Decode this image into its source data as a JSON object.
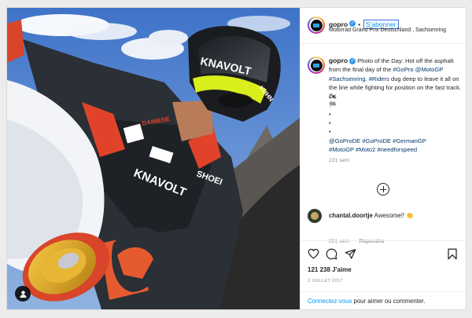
{
  "post": {
    "username": "gopro",
    "follow_label": "S'abonner",
    "location": "Motorrad Grand Prix Deutschland , Sachsenring",
    "photo_alt": "GoPro selfie of a MotoGP rider leaning on a motorcycle"
  },
  "caption": {
    "username": "gopro",
    "text_intro": "Photo of the Day: Hot off the asphalt from the final day of the ",
    "tag_gopro": "#GoPro",
    "tag_motogp": "@MotoGP",
    "tag_sachsenring": "#Sachsenring",
    "tag_riders": "#Riders",
    "text_middle": " dug deep to leave it all on the line while fighting for position on the fast track. ",
    "dots": "•",
    "tags_line1": "@GoProDE #GoProDE #GermanGP",
    "tags_line2": "#MotoGP #Moto2 #needforspeed",
    "time": "221 sem"
  },
  "comment": {
    "username": "chantal.doortje",
    "text": "Awesome!! ",
    "time": "221 sem",
    "reply_label": "Répondre"
  },
  "stats": {
    "likes": "121 238 J'aime",
    "date": "2 JUILLET 2017"
  },
  "login_prompt": {
    "link": "Connectez-vous",
    "text": " pour aimer ou commenter."
  },
  "colors": {
    "link_blue": "#0095f6",
    "tag_navy": "#00376b",
    "verified_blue": "#3897f0",
    "muted_gray": "#8e8e8e"
  },
  "icons": [
    "user-tag-icon",
    "verified-icon",
    "plus-circle-icon",
    "heart-icon",
    "comment-icon",
    "share-icon",
    "bookmark-icon",
    "checkered-flag-icon",
    "motorcycle-icon",
    "clapping-icon"
  ]
}
